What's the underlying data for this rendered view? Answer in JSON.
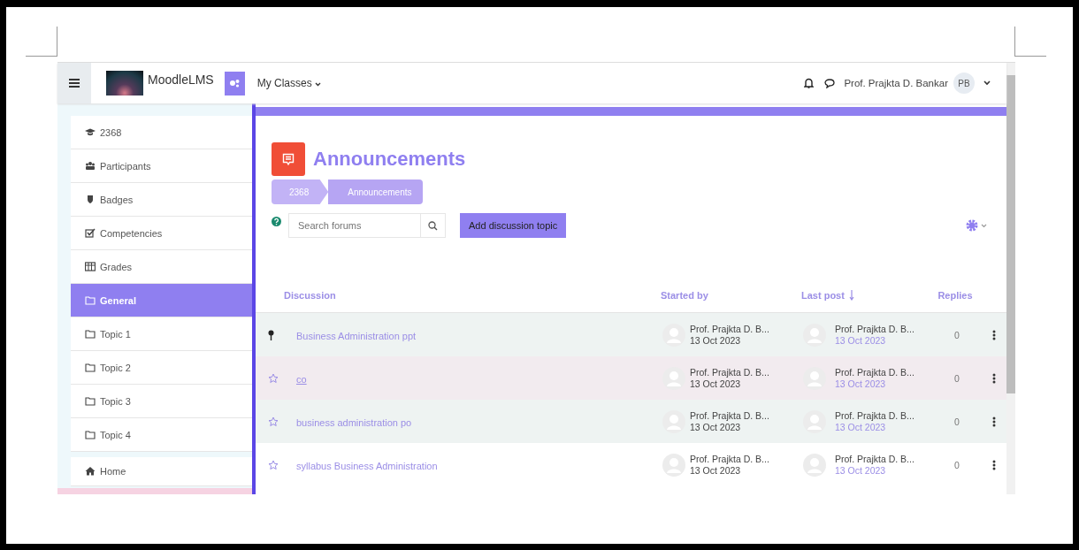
{
  "navbar": {
    "brand": "MoodleLMS",
    "menu": "My Classes",
    "user_name": "Prof. Prajkta D. Bankar",
    "user_initials": "PB"
  },
  "sidebar": {
    "items": [
      {
        "label": "2368",
        "kind": "course",
        "selected": false
      },
      {
        "label": "Participants",
        "kind": "participants",
        "selected": false
      },
      {
        "label": "Badges",
        "kind": "badges",
        "selected": false
      },
      {
        "label": "Competencies",
        "kind": "competencies",
        "selected": false
      },
      {
        "label": "Grades",
        "kind": "grades",
        "selected": false
      },
      {
        "label": "General",
        "kind": "section",
        "selected": true
      },
      {
        "label": "Topic 1",
        "kind": "section",
        "selected": false
      },
      {
        "label": "Topic 2",
        "kind": "section",
        "selected": false
      },
      {
        "label": "Topic 3",
        "kind": "section",
        "selected": false
      },
      {
        "label": "Topic 4",
        "kind": "section",
        "selected": false
      }
    ],
    "home": "Home"
  },
  "page": {
    "title": "Announcements",
    "breadcrumb": [
      "2368",
      "Announcements"
    ],
    "search": {
      "placeholder": "Search forums"
    },
    "add_button": "Add discussion topic"
  },
  "table": {
    "columns": [
      "Discussion",
      "Started by",
      "Last post",
      "Replies"
    ],
    "rows": [
      {
        "kind": "pinned",
        "hovered": false,
        "title": "Business Administration ppt",
        "started_by": "Prof. Prajkta D. B...",
        "started_date": "13 Oct 2023",
        "last_by": "Prof. Prajkta D. B...",
        "last_date": "13 Oct 2023",
        "replies": "0"
      },
      {
        "kind": "normal",
        "hovered": true,
        "title": "co",
        "started_by": "Prof. Prajkta D. B...",
        "started_date": "13 Oct 2023",
        "last_by": "Prof. Prajkta D. B...",
        "last_date": "13 Oct 2023",
        "replies": "0"
      },
      {
        "kind": "normal",
        "hovered": false,
        "title": "business administration po",
        "started_by": "Prof. Prajkta D. B...",
        "started_date": "13 Oct 2023",
        "last_by": "Prof. Prajkta D. B...",
        "last_date": "13 Oct 2023",
        "replies": "0"
      },
      {
        "kind": "normal",
        "hovered": false,
        "title": "syllabus Business Administration",
        "started_by": "Prof. Prajkta D. B...",
        "started_date": "13 Oct 2023",
        "last_by": "Prof. Prajkta D. B...",
        "last_date": "13 Oct 2023",
        "replies": "0"
      }
    ]
  }
}
